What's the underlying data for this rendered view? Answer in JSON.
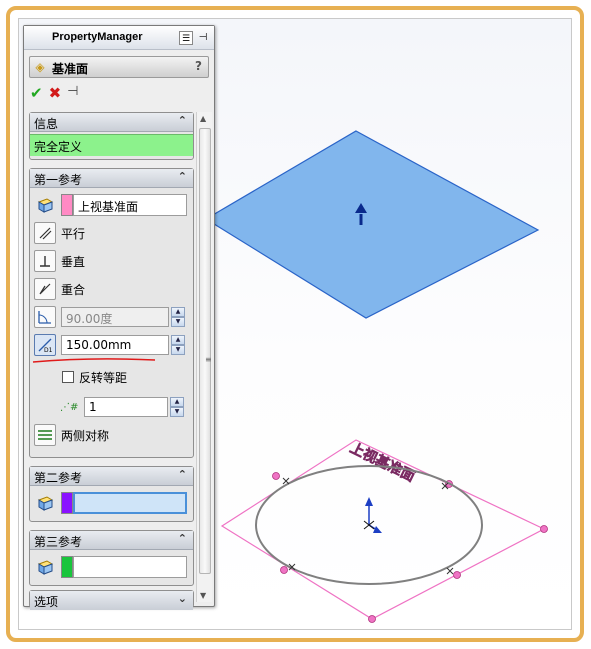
{
  "panel": {
    "title": "PropertyManager",
    "feature_name": "基准面",
    "help": "?"
  },
  "info_group": {
    "header": "信息",
    "status": "完全定义"
  },
  "first_reference": {
    "header": "第一参考",
    "selection": "上视基准面",
    "swatch_color": "#ff8ac4",
    "options": [
      {
        "label": "平行"
      },
      {
        "label": "垂直"
      },
      {
        "label": "重合"
      }
    ],
    "angle_value": "90.00度",
    "offset_value": "150.00mm",
    "flip_label": "反转等距",
    "count_value": "1",
    "symmetric_label": "两侧对称"
  },
  "second_reference": {
    "header": "第二参考",
    "swatch_color": "#8a12ff",
    "selection": ""
  },
  "third_reference": {
    "header": "第三参考",
    "swatch_color": "#19c53c",
    "selection": ""
  },
  "options_group": {
    "header": "选项"
  },
  "viewport": {
    "plane_label": "上视基准面",
    "new_plane_color": "#7ab2ec",
    "ref_plane_color": "#ef73c4",
    "annotation_color": "#e01a1a"
  }
}
